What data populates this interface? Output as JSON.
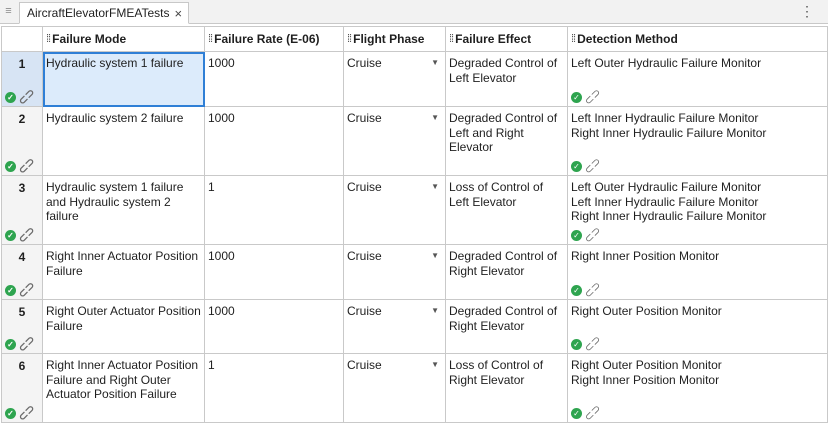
{
  "tab": {
    "title": "AircraftElevatorFMEATests",
    "close": "×"
  },
  "table": {
    "headers": [
      "Failure Mode",
      "Failure Rate (E-06)",
      "Flight Phase",
      "Failure Effect",
      "Detection Method"
    ],
    "rows": [
      {
        "num": "1",
        "mode": "Hydraulic system 1 failure",
        "rate": "1000",
        "phase": "Cruise",
        "effect": "Degraded Control of Left Elevator",
        "detection": [
          "Left Outer Hydraulic Failure Monitor"
        ]
      },
      {
        "num": "2",
        "mode": "Hydraulic system 2 failure",
        "rate": "1000",
        "phase": "Cruise",
        "effect": "Degraded Control of Left and Right Elevator",
        "detection": [
          "Left Inner Hydraulic Failure Monitor",
          "Right Inner Hydraulic Failure Monitor"
        ]
      },
      {
        "num": "3",
        "mode": "Hydraulic system 1 failure and Hydraulic system 2 failure",
        "rate": "1",
        "phase": "Cruise",
        "effect": "Loss of Control of Left Elevator",
        "detection": [
          "Left Outer Hydraulic Failure Monitor",
          "Left Inner Hydraulic Failure Monitor",
          "Right Inner Hydraulic Failure Monitor"
        ]
      },
      {
        "num": "4",
        "mode": "Right Inner Actuator Position Failure",
        "rate": "1000",
        "phase": "Cruise",
        "effect": "Degraded Control of Right Elevator",
        "detection": [
          "Right Inner Position Monitor"
        ]
      },
      {
        "num": "5",
        "mode": "Right Outer Actuator Position Failure",
        "rate": "1000",
        "phase": "Cruise",
        "effect": "Degraded Control of Right Elevator",
        "detection": [
          "Right Outer Position Monitor"
        ]
      },
      {
        "num": "6",
        "mode": "Right Inner Actuator Position Failure and Right Outer Actuator Position Failure",
        "rate": "1",
        "phase": "Cruise",
        "effect": "Loss of Control of Right Elevator",
        "detection": [
          "Right Outer Position Monitor",
          "Right Inner Position Monitor"
        ]
      }
    ]
  },
  "icons": {
    "status": "check-circle-icon",
    "link": "link-icon",
    "grip": "drag-grip-icon",
    "dropdown": "dropdown-caret-icon"
  },
  "colors": {
    "selection": "#2f7fd6",
    "selection_fill": "#dcebfb",
    "ok": "#2ea44f"
  }
}
